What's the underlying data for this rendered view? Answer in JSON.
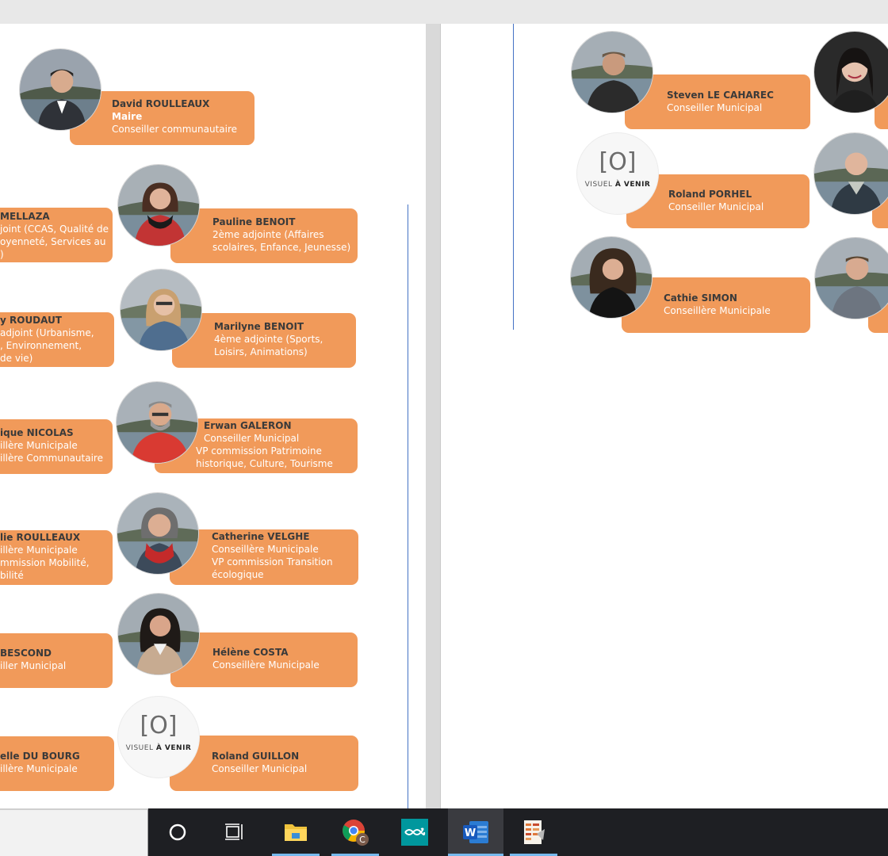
{
  "page1": {
    "mayor": {
      "name": "David ROULLEAUX",
      "role_bold": "Maire",
      "role": "Conseiller communautaire"
    },
    "left_column": [
      {
        "name": "MELLAZA",
        "l1": "joint (CCAS, Qualité de",
        "l2": "oyenneté, Services au",
        "l3": ")"
      },
      {
        "name": "y ROUDAUT",
        "l1": "adjoint (Urbanisme,",
        "l2": ", Environnement,",
        "l3": "de vie)"
      },
      {
        "name": "ique NICOLAS",
        "l1": "illère Municipale",
        "l2": "illère Communautaire"
      },
      {
        "name": "lie ROULLEAUX",
        "l1": "illère Municipale",
        "l2": "mmission Mobilité,",
        "l3": "bilité"
      },
      {
        "name": "BESCOND",
        "l1": "iller Municipal"
      },
      {
        "name": "elle DU BOURG",
        "l1": "illère Municipale"
      }
    ],
    "right_column": [
      {
        "name": "Pauline BENOIT",
        "l1": "2ème adjointe (Affaires",
        "l2": "scolaires, Enfance, Jeunesse)"
      },
      {
        "name": "Marilyne BENOIT",
        "l1": "4ème adjointe (Sports,",
        "l2": "Loisirs, Animations)"
      },
      {
        "name": "Erwan GALERON",
        "l1": "Conseiller Municipal",
        "l2": "VP commission Patrimoine",
        "l3": "historique, Culture, Tourisme"
      },
      {
        "name": "Catherine VELGHE",
        "l1": "Conseillère Municipale",
        "l2": "VP commission Transition",
        "l3": "écologique"
      },
      {
        "name": "Hélène COSTA",
        "l1": "Conseillère Municipale"
      },
      {
        "name": "Roland GUILLON",
        "l1": "Conseiller Municipal"
      }
    ]
  },
  "page2": {
    "members": [
      {
        "name": "Steven LE CAHAREC",
        "l1": "Conseiller Municipal"
      },
      {
        "name": "Roland PORHEL",
        "l1": "Conseiller Municipal"
      },
      {
        "name": "Cathie SIMON",
        "l1": "Conseillère Municipale"
      }
    ]
  },
  "placeholder": {
    "camera_glyph": "[O]",
    "text_a": "VISUEL",
    "text_b": "À VENIR"
  },
  "colors": {
    "card": "#f19a5a",
    "name_text": "#3a3a3a",
    "line": "#4472c4",
    "taskbar": "#1e1f23"
  },
  "taskbar": {
    "icons": [
      "cortana-icon",
      "task-view-icon",
      "file-explorer-icon",
      "chrome-icon",
      "arduino-icon",
      "word-icon",
      "document-app-icon"
    ],
    "chrome_badge": "C",
    "word_letter": "W"
  }
}
